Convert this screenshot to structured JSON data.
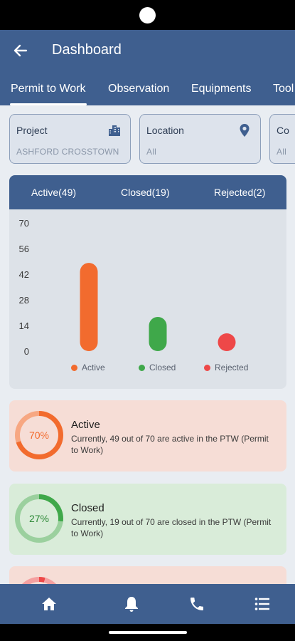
{
  "app": {
    "title": "Dashboard"
  },
  "tabs": [
    {
      "label": "Permit to Work",
      "active": true
    },
    {
      "label": "Observation"
    },
    {
      "label": "Equipments"
    },
    {
      "label": "Tool"
    }
  ],
  "filters": {
    "project": {
      "label": "Project",
      "value": "ASHFORD CROSSTOWN",
      "icon": "building-icon"
    },
    "location": {
      "label": "Location",
      "value": "All",
      "icon": "location-pin-icon"
    },
    "third": {
      "label": "Co",
      "value": "All"
    }
  },
  "chart_tabs": {
    "active": "Active(49)",
    "closed": "Closed(19)",
    "rejected": "Rejected(2)"
  },
  "chart_data": {
    "type": "bar",
    "categories": [
      "Active",
      "Closed",
      "Rejected"
    ],
    "values": [
      49,
      19,
      2
    ],
    "ylim": [
      0,
      70
    ],
    "yticks": [
      "70",
      "56",
      "42",
      "28",
      "14",
      "0"
    ],
    "colors": [
      "#f26b2e",
      "#3fa84a",
      "#ee4848"
    ],
    "legend_position": "bottom"
  },
  "summary": [
    {
      "title": "Active",
      "percent_label": "70%",
      "percent": 70,
      "description": "Currently, 49 out of 70 are active in the PTW (Permit to Work)",
      "bg": "#f6ddd6",
      "color": "#f26b2e",
      "track": "#f7a782"
    },
    {
      "title": "Closed",
      "percent_label": "27%",
      "percent": 27,
      "description": "Currently, 19 out of 70 are closed in the PTW (Permit to Work)",
      "bg": "#d9ecd9",
      "color": "#3fa84a",
      "track": "#9bd09e"
    }
  ],
  "bottom_nav": [
    "home-icon",
    "bell-icon",
    "phone-icon",
    "list-icon"
  ],
  "colors": {
    "primary": "#3f5f8f",
    "background": "#e9edf2"
  }
}
